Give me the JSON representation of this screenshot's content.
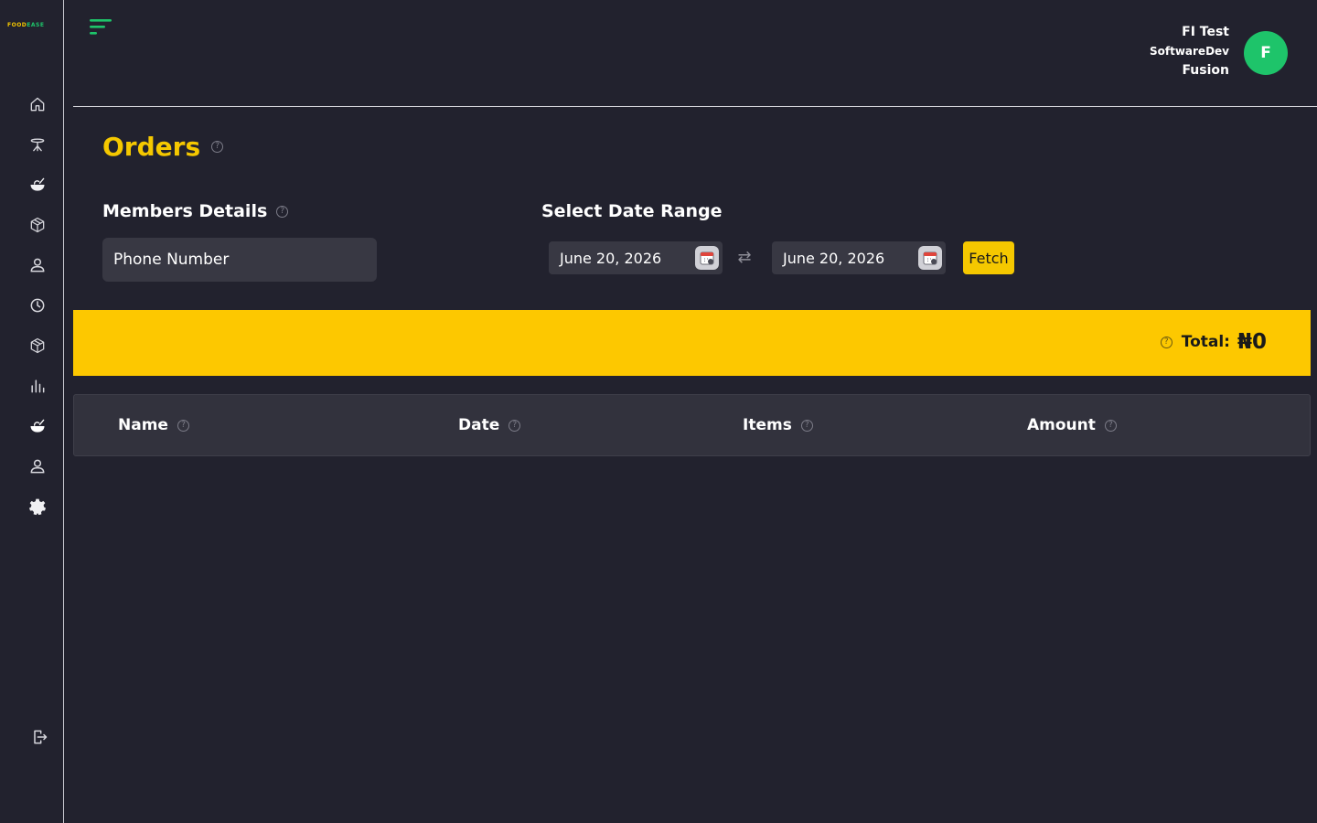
{
  "brand": {
    "logo_part1": "FOOD",
    "logo_part2": "EASE",
    "accent": "#f5c800",
    "green": "#1ec46a"
  },
  "sidebar": {
    "items": [
      {
        "icon": "home-icon"
      },
      {
        "icon": "dining-table-icon"
      },
      {
        "icon": "food-bowl-icon"
      },
      {
        "icon": "package-icon"
      },
      {
        "icon": "user-icon"
      },
      {
        "icon": "clock-icon"
      },
      {
        "icon": "package-icon"
      },
      {
        "icon": "bar-chart-icon"
      },
      {
        "icon": "food-bowl-icon"
      },
      {
        "icon": "user-icon"
      },
      {
        "icon": "settings-gear-icon"
      }
    ],
    "logout_icon": "logout-icon"
  },
  "header": {
    "user_line1": "FI Test",
    "user_line2": "SoftwareDev",
    "user_line3": "Fusion",
    "avatar_initial": "F"
  },
  "page": {
    "title": "Orders",
    "members_label": "Members Details",
    "phone_placeholder": "Phone Number",
    "date_range_label": "Select Date Range",
    "start_date": "June 20, 2026",
    "end_date": "June 20, 2026",
    "fetch_label": "Fetch",
    "total_label": "Total:",
    "total_value": "₦0"
  },
  "table": {
    "columns": [
      "Name",
      "Date",
      "Items",
      "Amount"
    ]
  }
}
